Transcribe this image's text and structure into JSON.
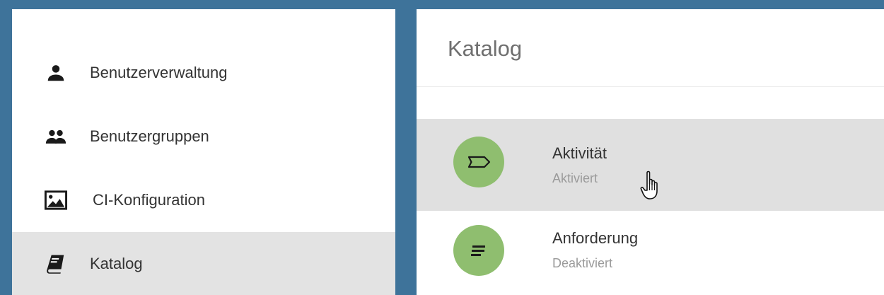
{
  "sidebar": {
    "items": [
      {
        "label": "Benutzerverwaltung",
        "icon": "person-icon",
        "active": false
      },
      {
        "label": "Benutzergruppen",
        "icon": "people-icon",
        "active": false
      },
      {
        "label": "CI-Konfiguration",
        "icon": "image-icon",
        "active": false
      },
      {
        "label": "Katalog",
        "icon": "book-icon",
        "active": true
      }
    ]
  },
  "main": {
    "title": "Katalog",
    "items": [
      {
        "title": "Aktivität",
        "status": "Aktiviert",
        "icon": "tag-outline-icon"
      },
      {
        "title": "Anforderung",
        "status": "Deaktiviert",
        "icon": "lines-icon"
      }
    ]
  },
  "colors": {
    "background": "#3e739a",
    "avatar": "#8fbe6f",
    "active_row": "#e3e3e3"
  }
}
